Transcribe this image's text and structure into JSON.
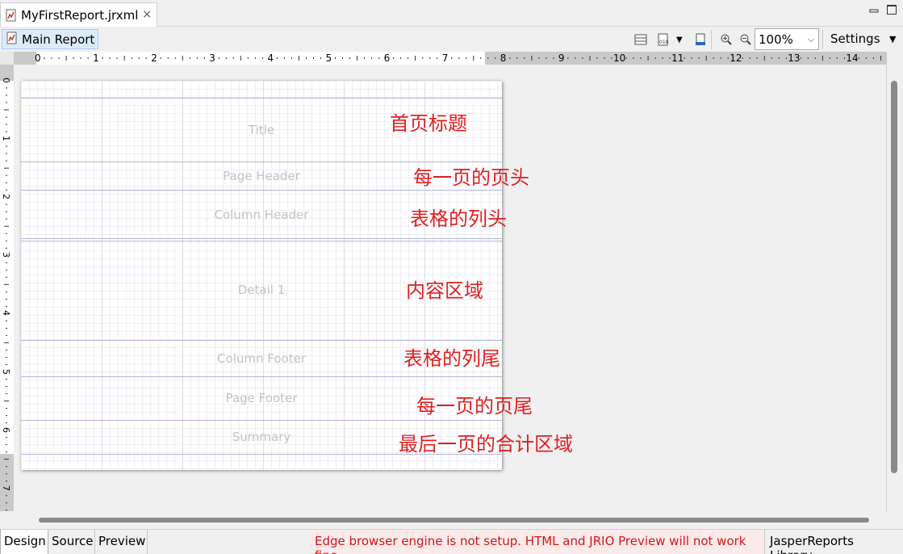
{
  "editor": {
    "file_tab": "MyFirstReport.jrxml",
    "close_glyph": "×"
  },
  "toolbar": {
    "main_report": "Main Report",
    "zoom_value": "100%",
    "settings": "Settings"
  },
  "ruler": {
    "h_labels": [
      "0",
      "1",
      "2",
      "3",
      "4",
      "5",
      "6",
      "7",
      "8",
      "9",
      "10",
      "11",
      "12",
      "13",
      "14"
    ],
    "v_labels": [
      "0",
      "1",
      "2",
      "3",
      "4",
      "5",
      "6",
      "7"
    ]
  },
  "bands": [
    {
      "label": "Title"
    },
    {
      "label": "Page Header"
    },
    {
      "label": "Column Header"
    },
    {
      "label": "Detail 1"
    },
    {
      "label": "Column Footer"
    },
    {
      "label": "Page Footer"
    },
    {
      "label": "Summary"
    }
  ],
  "annotations": [
    {
      "text": "首页标题"
    },
    {
      "text": "每一页的页头"
    },
    {
      "text": "表格的列头"
    },
    {
      "text": "内容区域"
    },
    {
      "text": "表格的列尾"
    },
    {
      "text": "每一页的页尾"
    },
    {
      "text": "最后一页的合计区域"
    }
  ],
  "bottom": {
    "tabs": [
      "Design",
      "Source",
      "Preview"
    ],
    "warning": "Edge browser engine is not setup. HTML and JRIO Preview will not work fine",
    "library": "JasperReports Library"
  },
  "colors": {
    "annotation": "#e02020",
    "band_label": "#c3c3c3",
    "warning_text": "#d01818"
  }
}
